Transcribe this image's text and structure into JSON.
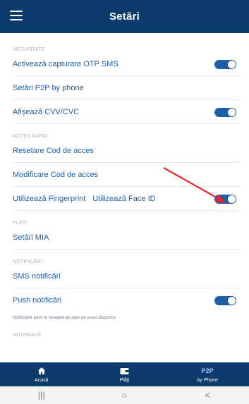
{
  "header": {
    "title": "Setări"
  },
  "sections": {
    "securitate": {
      "title": "SECURITATE",
      "items": [
        {
          "label": "Activează capturare OTP SMS",
          "toggle": true
        },
        {
          "label": "Setări P2P by phone"
        },
        {
          "label": "Afișează CVV/CVC",
          "toggle": true
        }
      ]
    },
    "acces": {
      "title": "ACCES RAPID",
      "items": [
        {
          "label": "Resetare Cod de acces"
        },
        {
          "label": "Modificare Cod de acces"
        },
        {
          "label": "Utilizează Fingerprint",
          "label2": "Utilizează Face ID",
          "toggle": true
        }
      ]
    },
    "plati": {
      "title": "PLĂȚI",
      "items": [
        {
          "label": "Setări MIA"
        }
      ]
    },
    "notificari": {
      "title": "NOTIFICĂRI",
      "items": [
        {
          "label": "SMS notificări"
        },
        {
          "label": "Push notificări",
          "toggle": true
        }
      ],
      "note": "Notificările push le recepționați doar pe acest dispozitiv."
    },
    "interfata": {
      "title": "INTERFAȚĂ"
    }
  },
  "tabbar": {
    "home": "Acasă",
    "plati": "Plăți",
    "p2p_top": "P2P",
    "p2p_bottom": "by Phone"
  },
  "sysnav": {
    "recents": "|||",
    "home": "○",
    "back": "<"
  },
  "colors": {
    "header_bg": "#0b3b6a",
    "accent": "#1f5fa8",
    "annotation_arrow": "#e8262a"
  }
}
